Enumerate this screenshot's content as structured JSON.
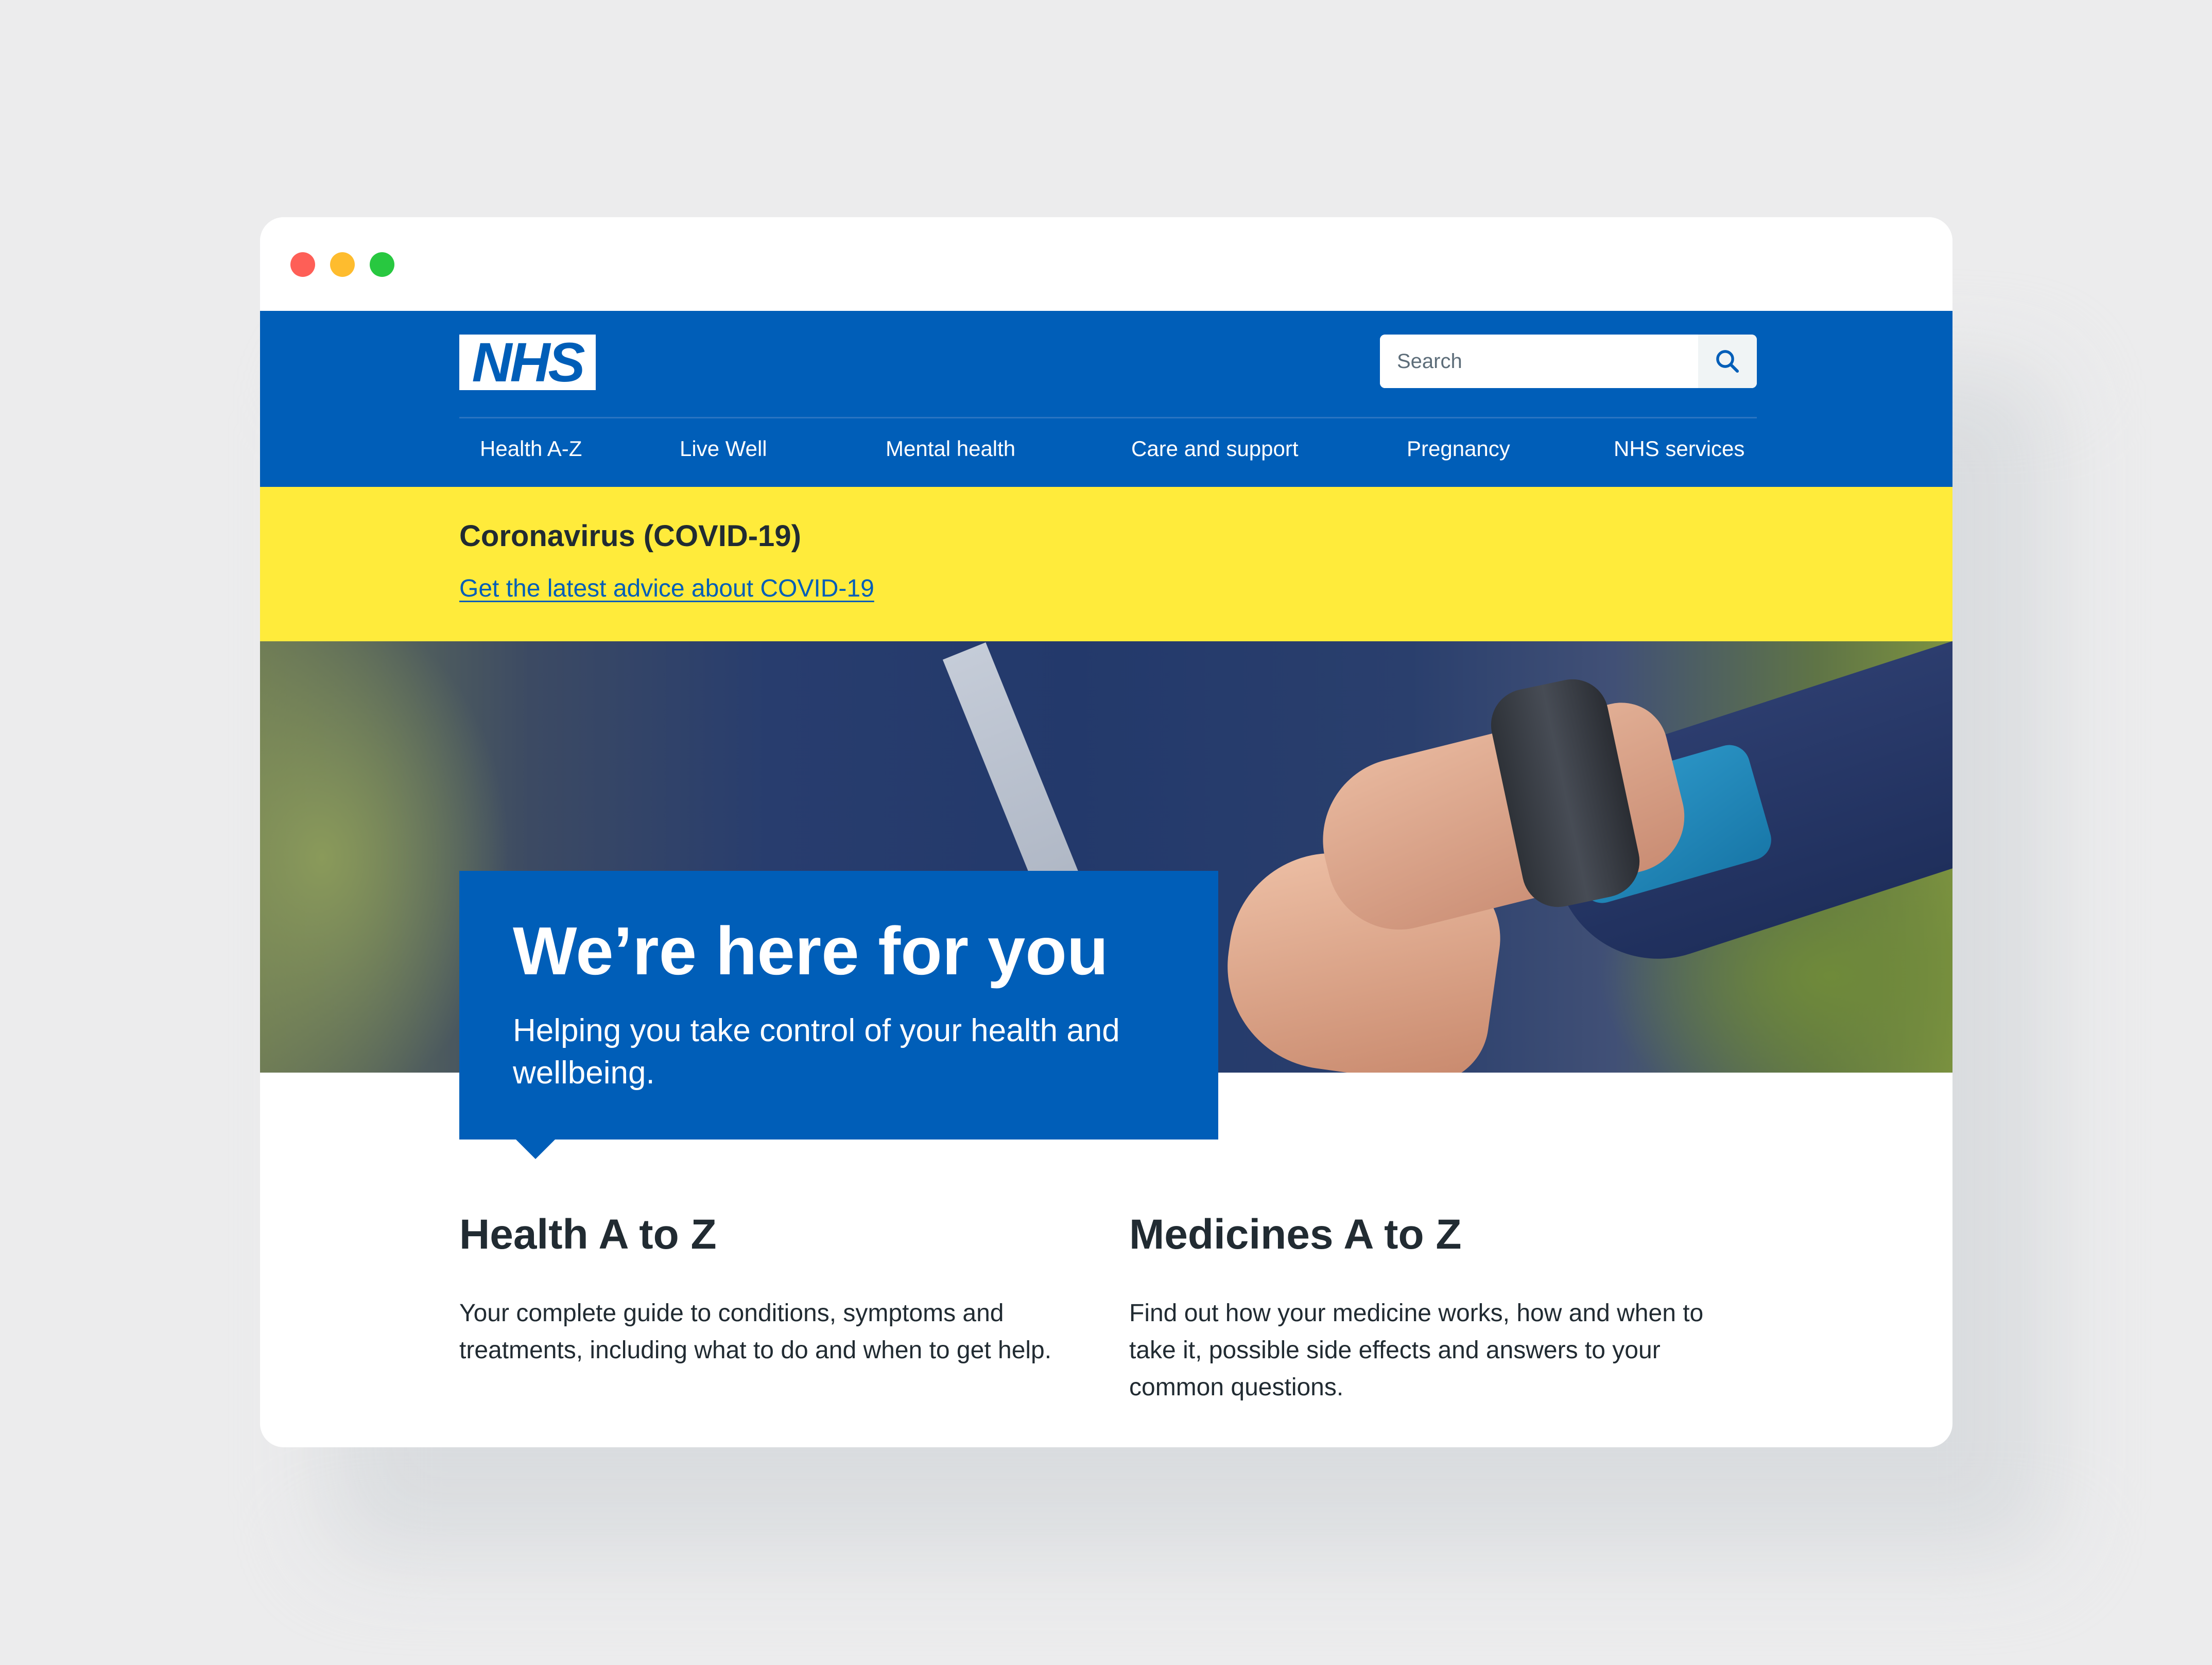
{
  "window": {
    "controls": [
      "close",
      "minimize",
      "maximize"
    ]
  },
  "header": {
    "logo_text": "NHS",
    "search": {
      "placeholder": "Search",
      "icon": "search-icon"
    },
    "nav": [
      "Health A-Z",
      "Live Well",
      "Mental health",
      "Care and support",
      "Pregnancy",
      "NHS services"
    ]
  },
  "alert": {
    "title": "Coronavirus (COVID-19)",
    "link": "Get the latest advice about COVID-19"
  },
  "hero": {
    "title": "We’re here for you",
    "subtitle": "Helping you take control of your health and wellbeing."
  },
  "cards": [
    {
      "title": "Health A to Z",
      "text": "Your complete guide to conditions, symptoms and treatments, including what to do and when to get help."
    },
    {
      "title": "Medicines A to Z",
      "text": "Find out how your medicine works, how and when to take it, possible side effects and answers to your common questions."
    }
  ],
  "colors": {
    "nhs_blue": "#005eb8",
    "alert_yellow": "#ffeb3b",
    "text": "#212b32",
    "background": "#ececed"
  }
}
